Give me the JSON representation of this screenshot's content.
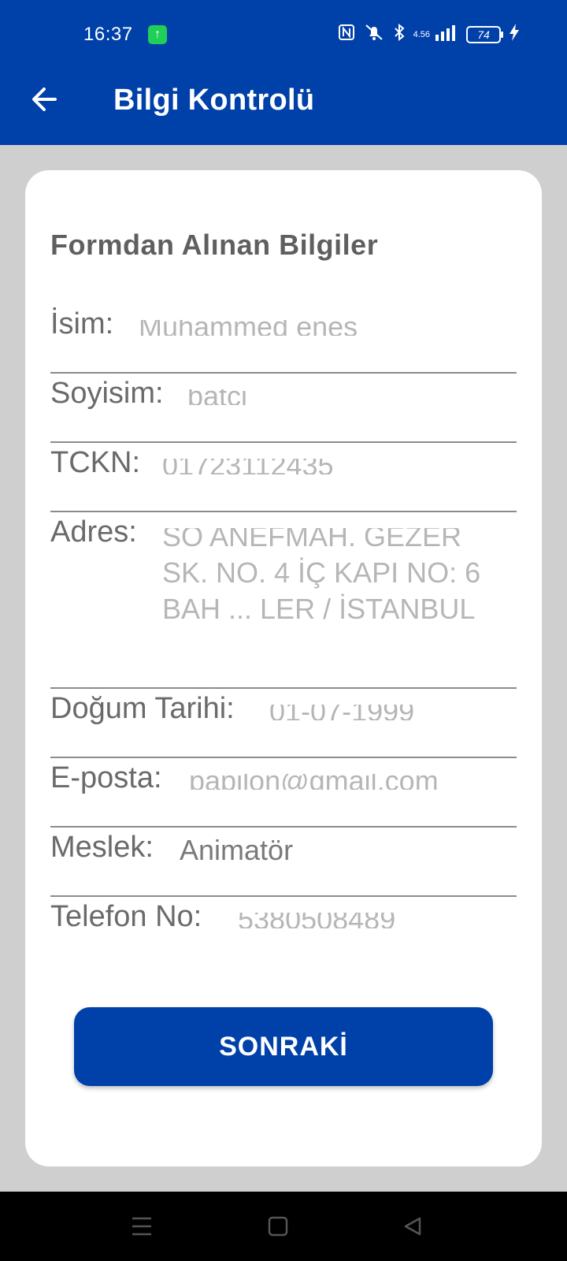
{
  "status_bar": {
    "time": "16:37",
    "network_speed": "4.56",
    "battery": "74",
    "icons": [
      "upload-app-icon",
      "nfc-icon",
      "mute-icon",
      "bluetooth-icon",
      "signal-icon",
      "battery-icon",
      "charging-icon"
    ]
  },
  "header": {
    "title": "Bilgi Kontrolü",
    "back_icon": "arrow-left-icon"
  },
  "card": {
    "section_title": "Formdan Alınan Bilgiler",
    "fields": [
      {
        "label": "İsim:",
        "value": "Muhammed enes"
      },
      {
        "label": "Soyisim:",
        "value": "batci"
      },
      {
        "label": "TCKN:",
        "value": "01723112435"
      },
      {
        "label": "Adres:",
        "value": "SO ANEFMAH. GEZER SK. NO. 4 İÇ KAPI NO: 6 BAH ... LER / İSTANBUL"
      },
      {
        "label": "Doğum Tarihi:",
        "value": "01-07-1999"
      },
      {
        "label": "E-posta:",
        "value": "papilon@gmail.com"
      },
      {
        "label": "Meslek:",
        "value": "Animatör"
      },
      {
        "label": "Telefon No:",
        "value": "5380508489"
      }
    ]
  },
  "next_button": {
    "label": "SONRAKİ"
  },
  "colors": {
    "primary": "#0040a9",
    "background": "#cfcfcf",
    "card": "#ffffff",
    "label_text": "#6a6a6a"
  },
  "nav_bar": {
    "icons": [
      "menu-icon",
      "home-square-icon",
      "back-triangle-icon"
    ]
  }
}
